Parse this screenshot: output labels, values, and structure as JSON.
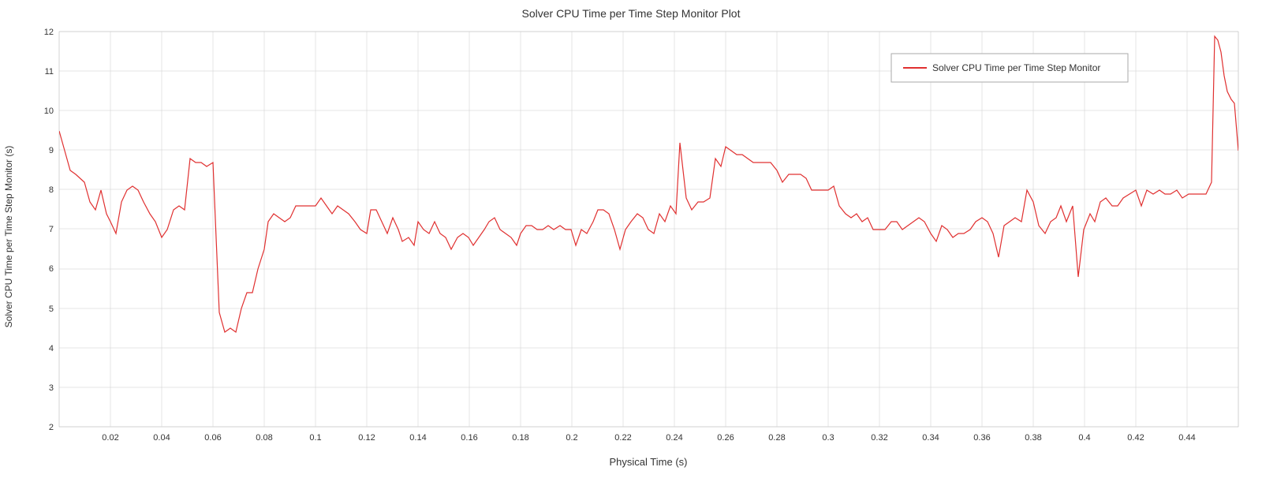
{
  "chart": {
    "title": "Solver CPU Time per Time Step Monitor Plot",
    "xAxisLabel": "Physical Time (s)",
    "yAxisLabel": "Solver CPU Time per Time Step Monitor (s)",
    "legendLabel": "Solver CPU Time per Time Step Monitor",
    "xMin": 0,
    "xMax": 0.46,
    "yMin": 2,
    "yMax": 12,
    "lineColor": "#e03030",
    "backgroundColor": "#ffffff",
    "gridColor": "#cccccc"
  }
}
